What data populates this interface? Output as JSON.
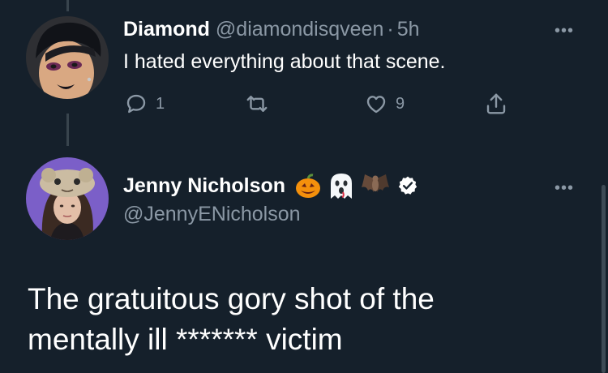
{
  "reply_tweet": {
    "display_name": "Diamond",
    "handle": "@diamondisqveen",
    "separator": "·",
    "time": "5h",
    "text": "I hated everything about that scene.",
    "actions": {
      "reply_count": "1",
      "retweet_count": "",
      "like_count": "9"
    }
  },
  "main_tweet": {
    "display_name": "Jenny Nicholson",
    "name_emojis": [
      "jack-o-lantern-emoji",
      "ghost-emoji",
      "bat-emoji"
    ],
    "verified": true,
    "handle": "@JennyENicholson",
    "text_line1": "The gratuitous gory shot of the",
    "text_line2": "mentally ill ******* victim"
  },
  "more_glyph": "•••",
  "colors": {
    "background": "#15202b",
    "text": "#ffffff",
    "muted": "#8b98a5",
    "thread_line": "#38444d",
    "verified_badge": "#ffffff"
  }
}
